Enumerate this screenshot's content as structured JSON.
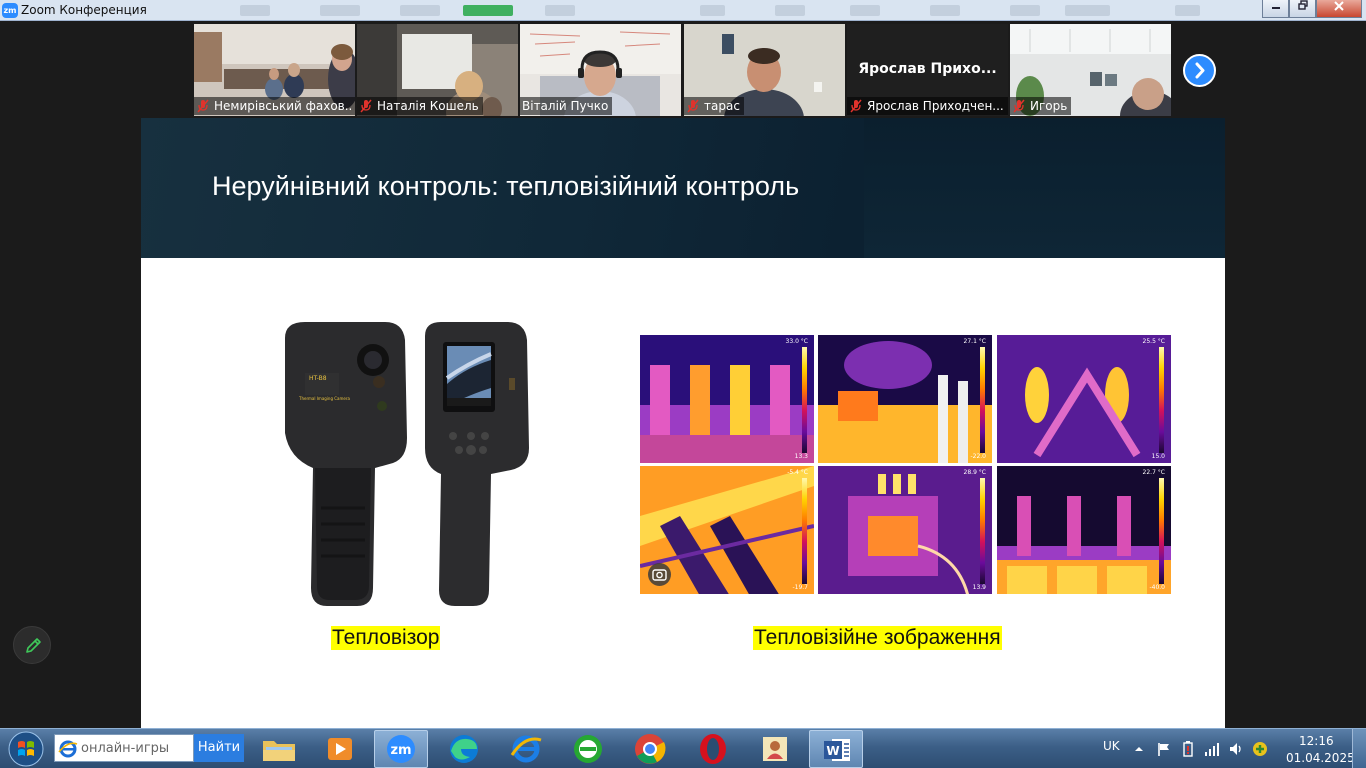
{
  "window": {
    "app_icon_text": "zm",
    "title": "Zoom Конференция"
  },
  "gallery": {
    "participants": [
      {
        "name": "Немирівський фахов..."
      },
      {
        "name": "Наталія Кошель"
      },
      {
        "name": "Віталій Пучко"
      },
      {
        "name": "тарас"
      },
      {
        "name": "Ярослав Приходчен...",
        "display": "Ярослав  Прихо..."
      },
      {
        "name": "Игорь"
      }
    ]
  },
  "slide": {
    "title": "Неруйнівний контроль: тепловізійний контроль",
    "caption_left": "Тепловізор",
    "caption_right": "Тепловізійне зображення",
    "camera": {
      "model": "HT-B8",
      "brand_line": "Thermal Imaging Camera"
    },
    "thermal_images": [
      {
        "top": "33.0 °C",
        "bottom": "13.3"
      },
      {
        "top": "27.1 °C",
        "bottom": "-22.0"
      },
      {
        "top": "25.5 °C",
        "bottom": "15.0"
      },
      {
        "top": "-5.4 °C",
        "bottom": "-19.7"
      },
      {
        "top": "28.9 °C",
        "bottom": "13.9"
      },
      {
        "top": "22.7 °C",
        "bottom": "-40.0"
      }
    ]
  },
  "taskbar": {
    "search_placeholder": "онлайн-игры",
    "search_button": "Найти",
    "zoom_label": "zm",
    "word_label": "W",
    "language": "UK",
    "time": "12:16",
    "date": "01.04.2025"
  },
  "colors": {
    "zoom_blue": "#2d8cff",
    "highlight_yellow": "#ffff00",
    "mute_red": "#e0332c"
  }
}
